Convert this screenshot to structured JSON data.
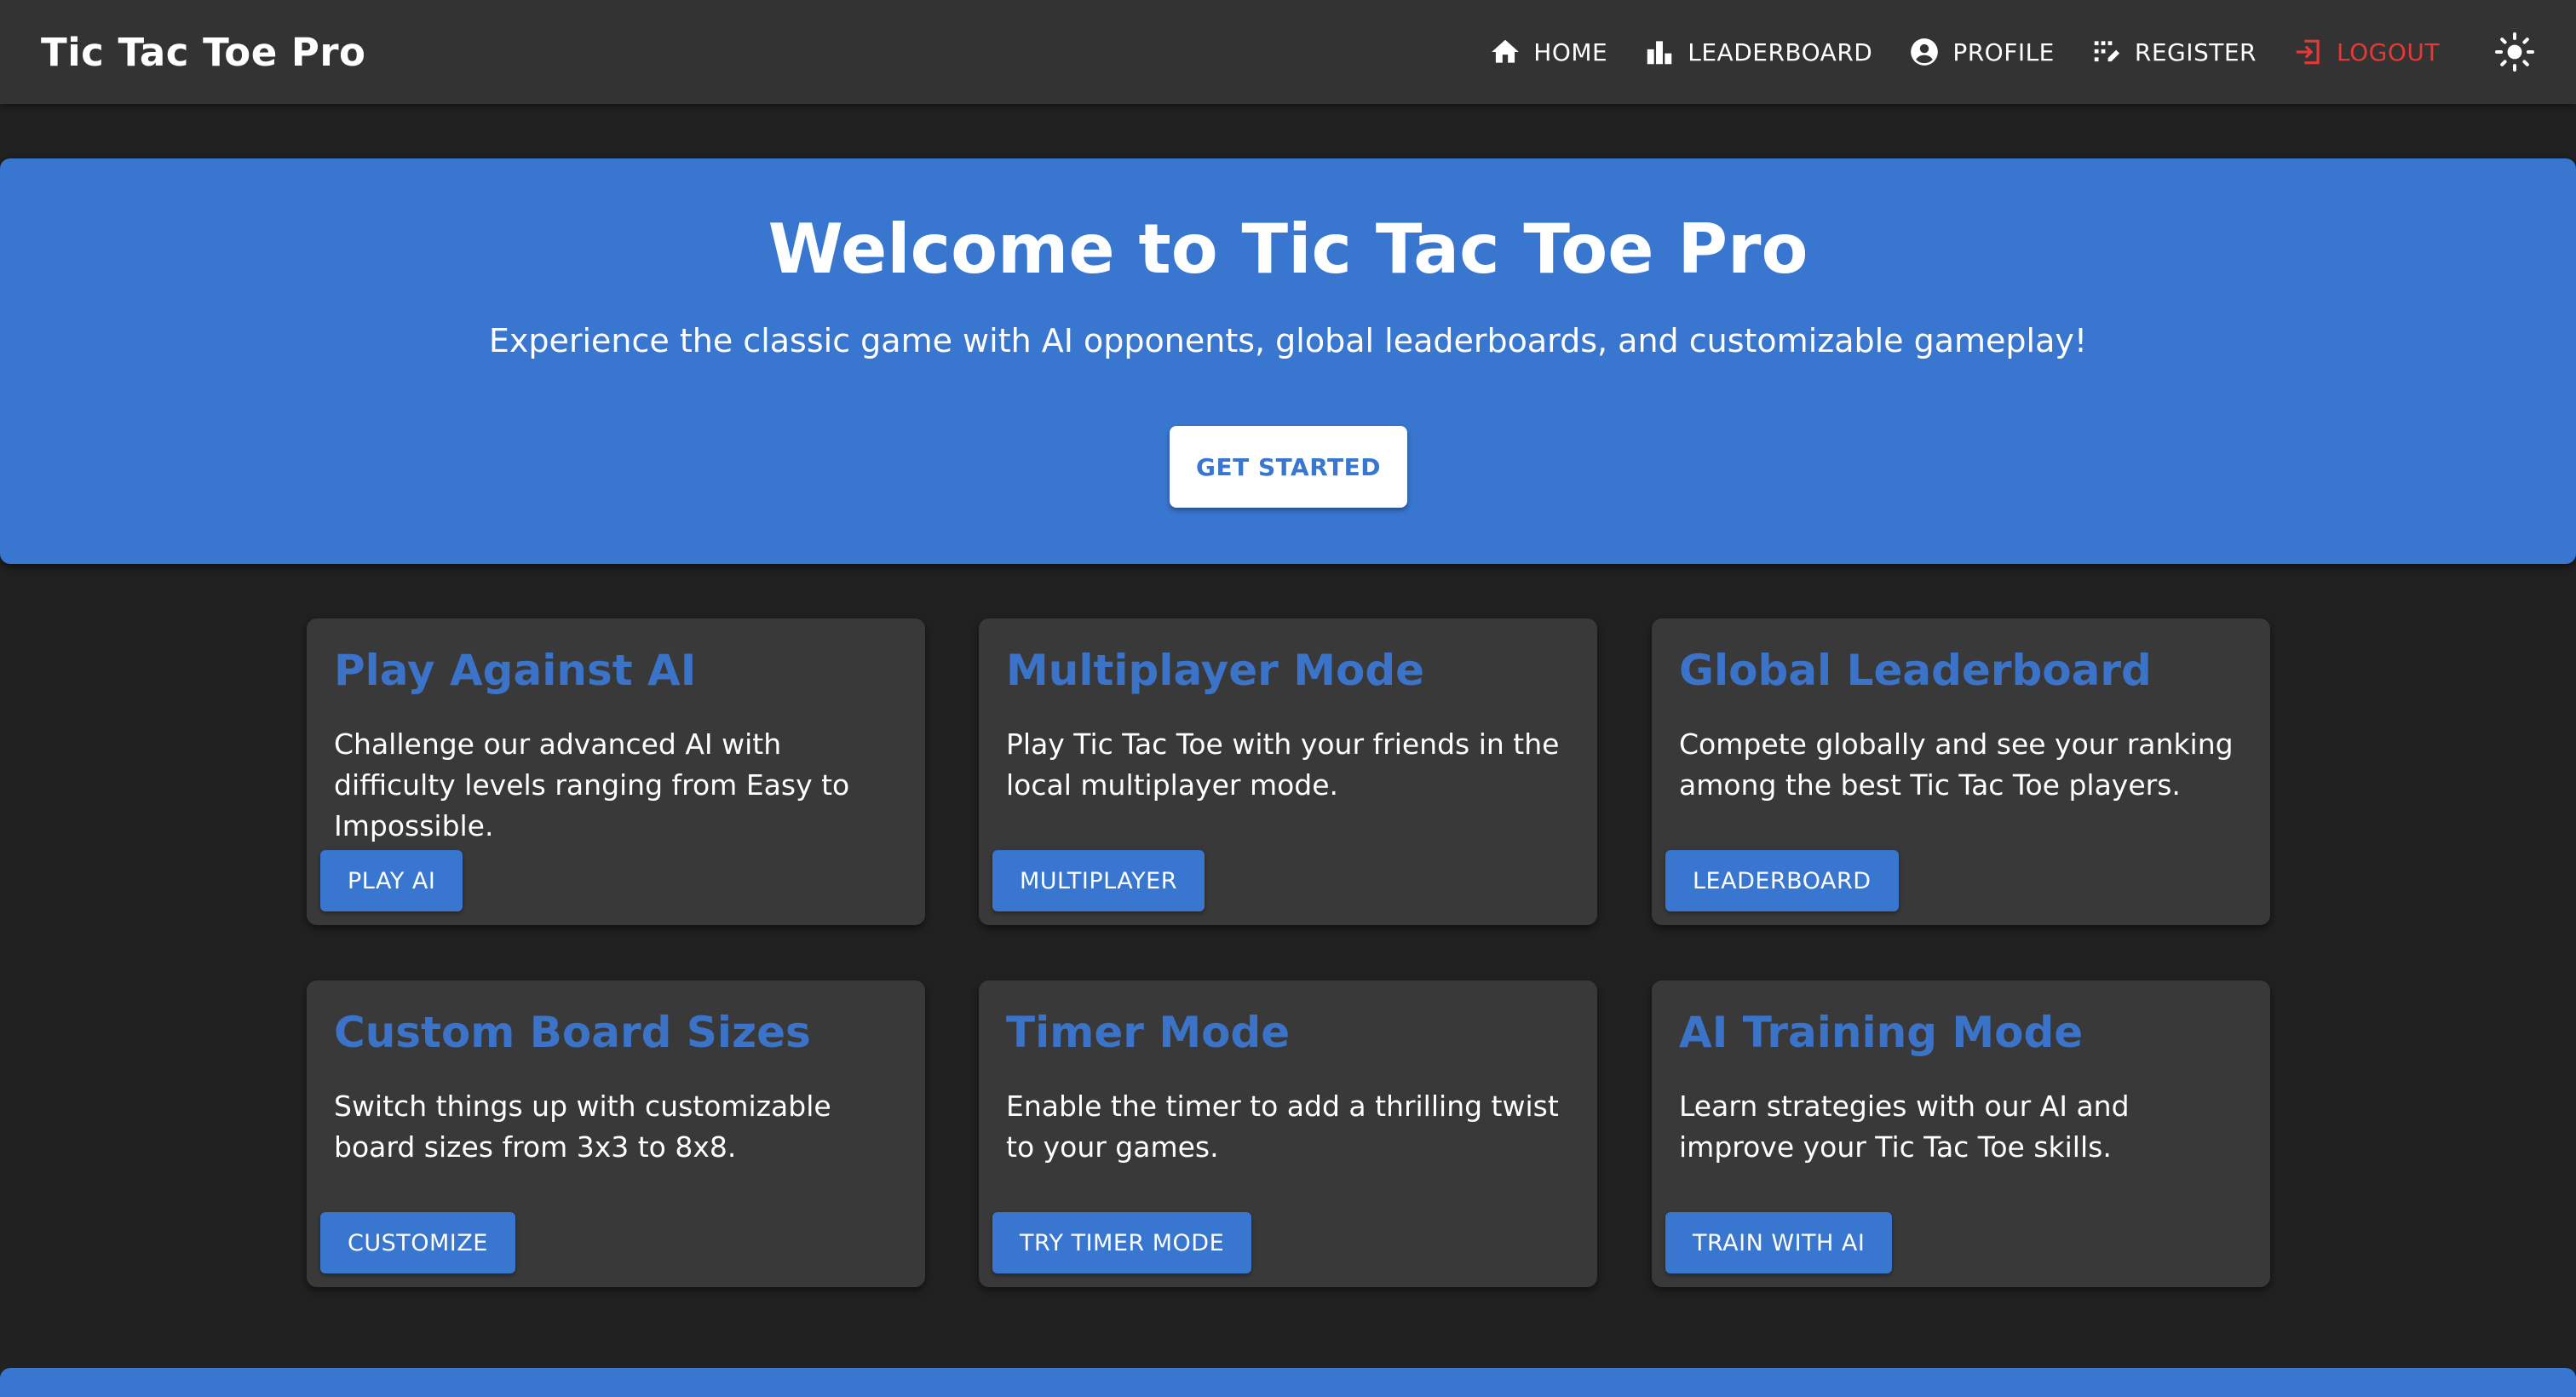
{
  "app": {
    "title": "Tic Tac Toe Pro"
  },
  "nav": {
    "items": [
      {
        "label": "HOME",
        "icon": "home-icon"
      },
      {
        "label": "LEADERBOARD",
        "icon": "leaderboard-icon"
      },
      {
        "label": "PROFILE",
        "icon": "account-icon"
      },
      {
        "label": "REGISTER",
        "icon": "register-icon"
      },
      {
        "label": "LOGOUT",
        "icon": "logout-icon"
      }
    ],
    "theme_toggle_icon": "sun-icon"
  },
  "hero": {
    "title": "Welcome to Tic Tac Toe Pro",
    "subtitle": "Experience the classic game with AI opponents, global leaderboards, and customizable gameplay!",
    "cta_label": "GET STARTED"
  },
  "cards": [
    {
      "title": "Play Against AI",
      "description": "Challenge our advanced AI with difficulty levels ranging from Easy to Impossible.",
      "button": "PLAY AI"
    },
    {
      "title": "Multiplayer Mode",
      "description": "Play Tic Tac Toe with your friends in the local multiplayer mode.",
      "button": "MULTIPLAYER"
    },
    {
      "title": "Global Leaderboard",
      "description": "Compete globally and see your ranking among the best Tic Tac Toe players.",
      "button": "LEADERBOARD"
    },
    {
      "title": "Custom Board Sizes",
      "description": "Switch things up with customizable board sizes from 3x3 to 8x8.",
      "button": "CUSTOMIZE"
    },
    {
      "title": "Timer Mode",
      "description": "Enable the timer to add a thrilling twist to your games.",
      "button": "TRY TIMER MODE"
    },
    {
      "title": "AI Training Mode",
      "description": "Learn strategies with our AI and improve your Tic Tac Toe skills.",
      "button": "TRAIN WITH AI"
    }
  ],
  "colors": {
    "background": "#212121",
    "navbar": "#333333",
    "accent": "#3876cf",
    "card": "#393939",
    "logout": "#e53935"
  }
}
